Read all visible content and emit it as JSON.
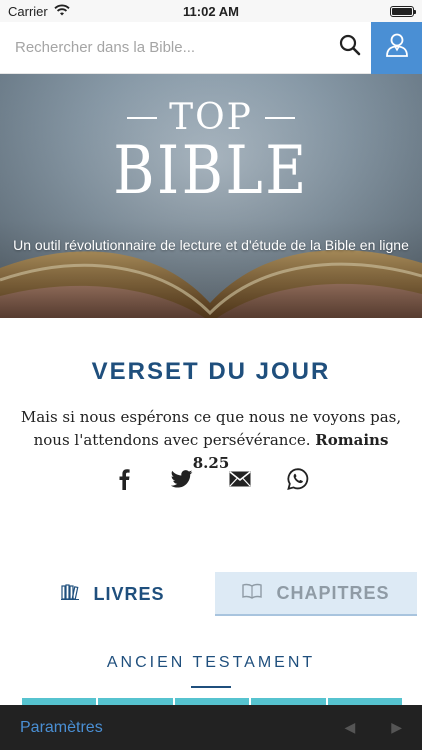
{
  "status_bar": {
    "carrier": "Carrier",
    "time": "11:02 AM",
    "wifi_icon": "wifi-icon",
    "battery_icon": "battery-icon"
  },
  "search": {
    "placeholder": "Rechercher dans la Bible...",
    "value": "",
    "search_icon": "search-icon",
    "user_icon": "user-icon"
  },
  "hero": {
    "title_top": "TOP",
    "title_main": "BIBLE",
    "tagline": "Un outil révolutionnaire de lecture et d'étude de la Bible en ligne"
  },
  "verse_of_day": {
    "heading": "VERSET DU JOUR",
    "text": "Mais si nous espérons ce que nous ne voyons pas, nous l'attendons avec persévérance.",
    "reference": "Romains 8.25",
    "share": [
      "facebook-icon",
      "twitter-icon",
      "email-icon",
      "whatsapp-icon"
    ]
  },
  "tabs": {
    "books": {
      "label": "LIVRES",
      "icon": "books-icon",
      "active": true
    },
    "chapters": {
      "label": "CHAPITRES",
      "icon": "open-book-icon",
      "active": false
    }
  },
  "section": {
    "testament": "ANCIEN TESTAMENT"
  },
  "toolbar": {
    "settings_label": "Paramètres",
    "prev_symbol": "◀",
    "next_symbol": "▶"
  },
  "colors": {
    "primary": "#1f4f7d",
    "accent": "#4a8fd4",
    "tile": "#56c3cf",
    "inactive_tab": "#ddeaf5",
    "toolbar": "#222222"
  }
}
